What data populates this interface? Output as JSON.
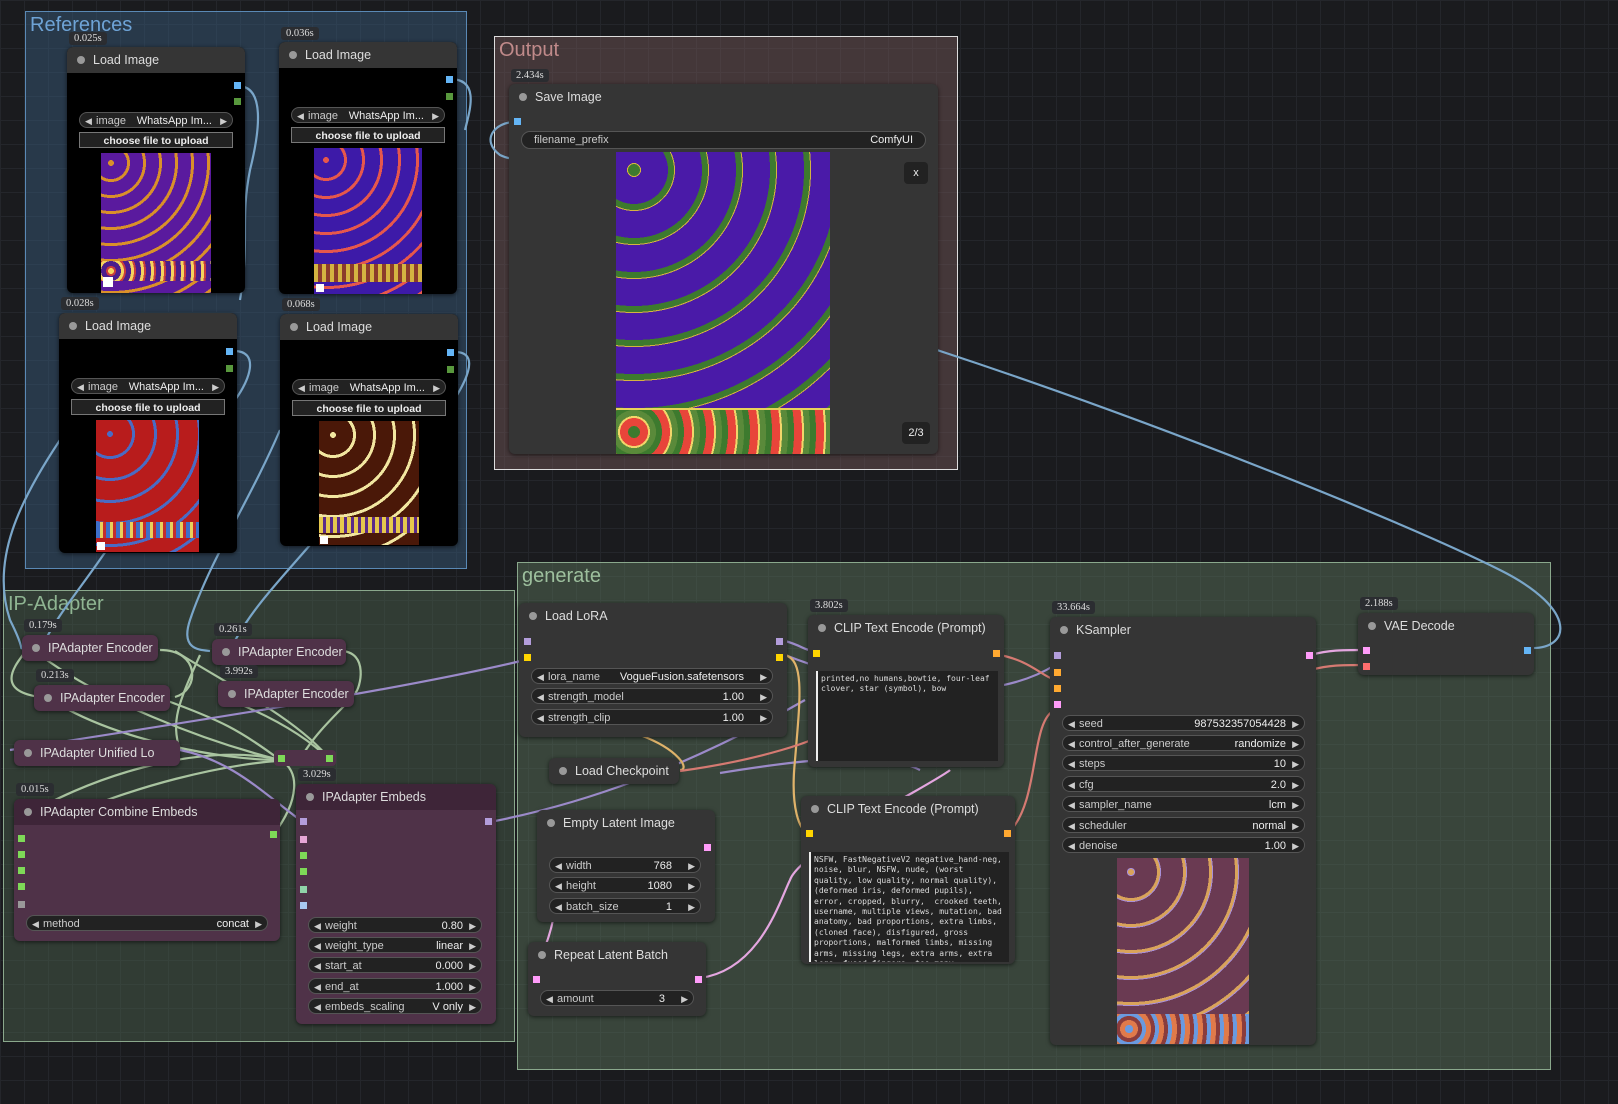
{
  "groups": {
    "references": "References",
    "output": "Output",
    "ip_adapter": "IP-Adapter",
    "generate": "generate"
  },
  "nodes": {
    "load1": {
      "title": "Load Image",
      "time": "0.025s",
      "image_label": "image",
      "image_value": "WhatsApp Im...",
      "upload": "choose file to upload"
    },
    "load2": {
      "title": "Load Image",
      "time": "0.036s",
      "image_label": "image",
      "image_value": "WhatsApp Im...",
      "upload": "choose file to upload"
    },
    "load3": {
      "title": "Load Image",
      "time": "0.028s",
      "image_label": "image",
      "image_value": "WhatsApp Im...",
      "upload": "choose file to upload"
    },
    "load4": {
      "title": "Load Image",
      "time": "0.068s",
      "image_label": "image",
      "image_value": "WhatsApp Im...",
      "upload": "choose file to upload"
    },
    "save": {
      "title": "Save Image",
      "time": "2.434s",
      "prefix_label": "filename_prefix",
      "prefix_value": "ComfyUI",
      "close": "x",
      "counter": "2/3"
    },
    "enc1": {
      "title": "IPAdapter Encoder",
      "time": "0.179s"
    },
    "enc2": {
      "title": "IPAdapter Encoder",
      "time": "0.213s"
    },
    "enc3": {
      "title": "IPAdapter Encoder",
      "time": "0.261s"
    },
    "enc4": {
      "title": "IPAdapter Encoder",
      "time": "3.992s"
    },
    "unified": {
      "title": "IPAdapter Unified Lo"
    },
    "combine": {
      "title": "IPAdapter Combine Embeds",
      "time": "0.015s",
      "method_label": "method",
      "method_value": "concat"
    },
    "embeds": {
      "title": "IPAdapter Embeds",
      "time": "3.029s",
      "widgets": [
        {
          "label": "weight",
          "value": "0.80"
        },
        {
          "label": "weight_type",
          "value": "linear"
        },
        {
          "label": "start_at",
          "value": "0.000"
        },
        {
          "label": "end_at",
          "value": "1.000"
        },
        {
          "label": "embeds_scaling",
          "value": "V only"
        }
      ]
    },
    "lora": {
      "title": "Load LoRA",
      "widgets": [
        {
          "label": "lora_name",
          "value": "VogueFusion.safetensors"
        },
        {
          "label": "strength_model",
          "value": "1.00"
        },
        {
          "label": "strength_clip",
          "value": "1.00"
        }
      ]
    },
    "checkpoint": {
      "title": "Load Checkpoint"
    },
    "latent": {
      "title": "Empty Latent Image",
      "widgets": [
        {
          "label": "width",
          "value": "768"
        },
        {
          "label": "height",
          "value": "1080"
        },
        {
          "label": "batch_size",
          "value": "1"
        }
      ]
    },
    "repeat": {
      "title": "Repeat Latent Batch",
      "widgets": [
        {
          "label": "amount",
          "value": "3"
        }
      ]
    },
    "clip_pos": {
      "title": "CLIP Text Encode (Prompt)",
      "time": "3.802s",
      "text": "printed,no humans,bowtie, four-leaf clover, star (symbol), bow"
    },
    "clip_neg": {
      "title": "CLIP Text Encode (Prompt)",
      "text": "NSFW, FastNegativeV2 negative_hand-neg, noise, blur, NSFW, nude, (worst quality, low quality, normal quality), (deformed iris, deformed pupils), error, cropped, blurry,  crooked teeth, username, multiple views, mutation, bad anatomy, bad proportions, extra limbs, (cloned face), disfigured, gross proportions, malformed limbs, missing arms, missing legs, extra arms, extra legs, fused fingers, too many"
    },
    "ksampler": {
      "title": "KSampler",
      "time": "33.664s",
      "widgets": [
        {
          "label": "seed",
          "value": "987532357054428"
        },
        {
          "label": "control_after_generate",
          "value": "randomize"
        },
        {
          "label": "steps",
          "value": "10"
        },
        {
          "label": "cfg",
          "value": "2.0"
        },
        {
          "label": "sampler_name",
          "value": "lcm"
        },
        {
          "label": "scheduler",
          "value": "normal"
        },
        {
          "label": "denoise",
          "value": "1.00"
        }
      ]
    },
    "vae": {
      "title": "VAE Decode",
      "time": "2.188s"
    }
  },
  "colors": {
    "canvas": "#1a1b1e",
    "references_group": "#3a5f80",
    "output_group": "#8a6a6a",
    "ip_group": "#4d6650",
    "generate_group": "#5f7a5f",
    "purple_node": "#4f3248",
    "image_socket": "#64b5f6",
    "latent_socket": "#ff9cf9",
    "clip_socket": "#ffd500",
    "model_socket": "#b39ddb",
    "cond_socket": "#ffa931",
    "embeds_socket": "#7ed957"
  }
}
